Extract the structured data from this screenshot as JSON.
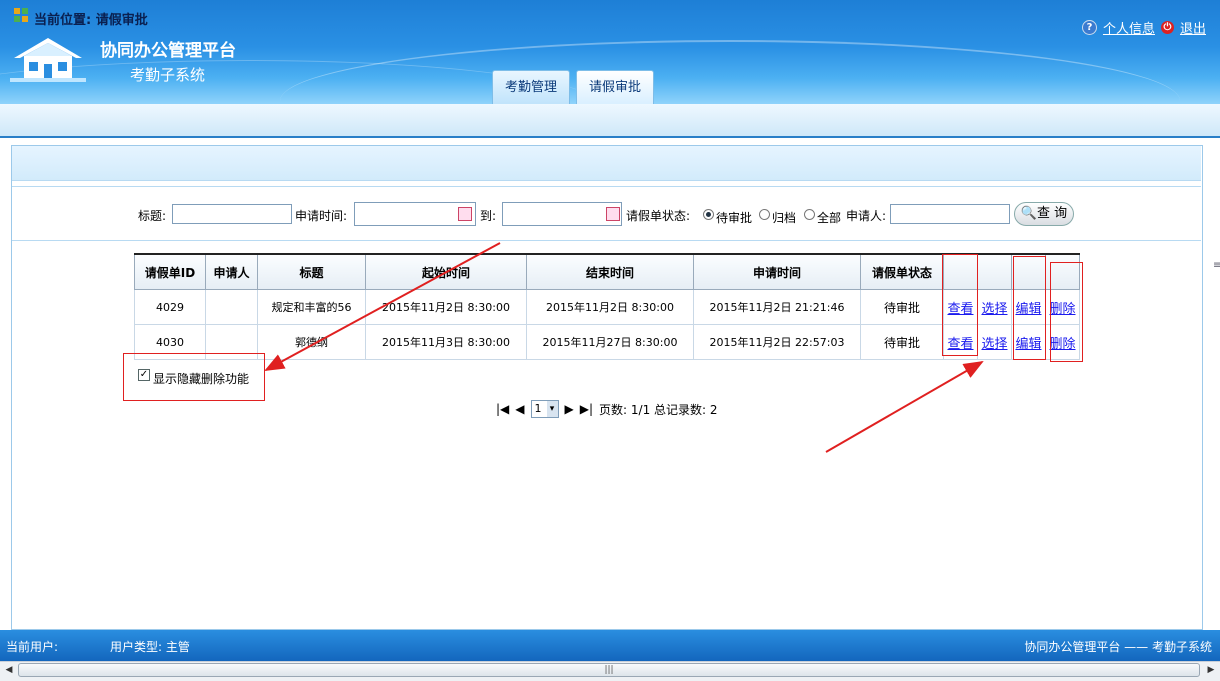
{
  "header": {
    "title": "协同办公管理平台",
    "subtitle": "考勤子系统",
    "links": {
      "profile": "个人信息",
      "logout": "退出"
    },
    "tabs": [
      {
        "label": "考勤管理",
        "active": false
      },
      {
        "label": "请假审批",
        "active": true
      }
    ]
  },
  "breadcrumb": {
    "prefix": "当前位置:",
    "page": "请假审批"
  },
  "search": {
    "title_label": "标题:",
    "title_value": "",
    "apply_time_label": "申请时间:",
    "to_label": "到:",
    "status_label": "请假单状态:",
    "status_options": [
      {
        "label": "待审批",
        "checked": true
      },
      {
        "label": "归档",
        "checked": false
      },
      {
        "label": "全部",
        "checked": false
      }
    ],
    "applicant_label": "申请人:",
    "search_button": "查 询"
  },
  "table": {
    "columns": [
      "请假单ID",
      "申请人",
      "标题",
      "起始时间",
      "结束时间",
      "申请时间",
      "请假单状态",
      "",
      "",
      "",
      ""
    ],
    "rows": [
      {
        "id": "4029",
        "applicant": "",
        "title": "规定和丰富的56",
        "start": "2015年11月2日 8:30:00",
        "end": "2015年11月2日 8:30:00",
        "applied": "2015年11月2日 21:21:46",
        "status": "待审批"
      },
      {
        "id": "4030",
        "applicant": "",
        "title": "郭德纲",
        "start": "2015年11月3日 8:30:00",
        "end": "2015年11月27日 8:30:00",
        "applied": "2015年11月2日 22:57:03",
        "status": "待审批"
      }
    ],
    "actions": {
      "view": "查看",
      "select": "选择",
      "edit": "编辑",
      "delete": "删除"
    }
  },
  "toggle": {
    "label": "显示隐藏删除功能",
    "checked": true
  },
  "pager": {
    "current": "1",
    "info": "页数: 1/1 总记录数: 2"
  },
  "footer": {
    "current_user": "当前用户:",
    "user_type": "用户类型: 主管",
    "right_text": "协同办公管理平台 —— 考勤子系统"
  },
  "colors": {
    "header_blue": "#1e7fd6",
    "annotation_red": "#e02020",
    "link_blue": "#1a1aee"
  }
}
